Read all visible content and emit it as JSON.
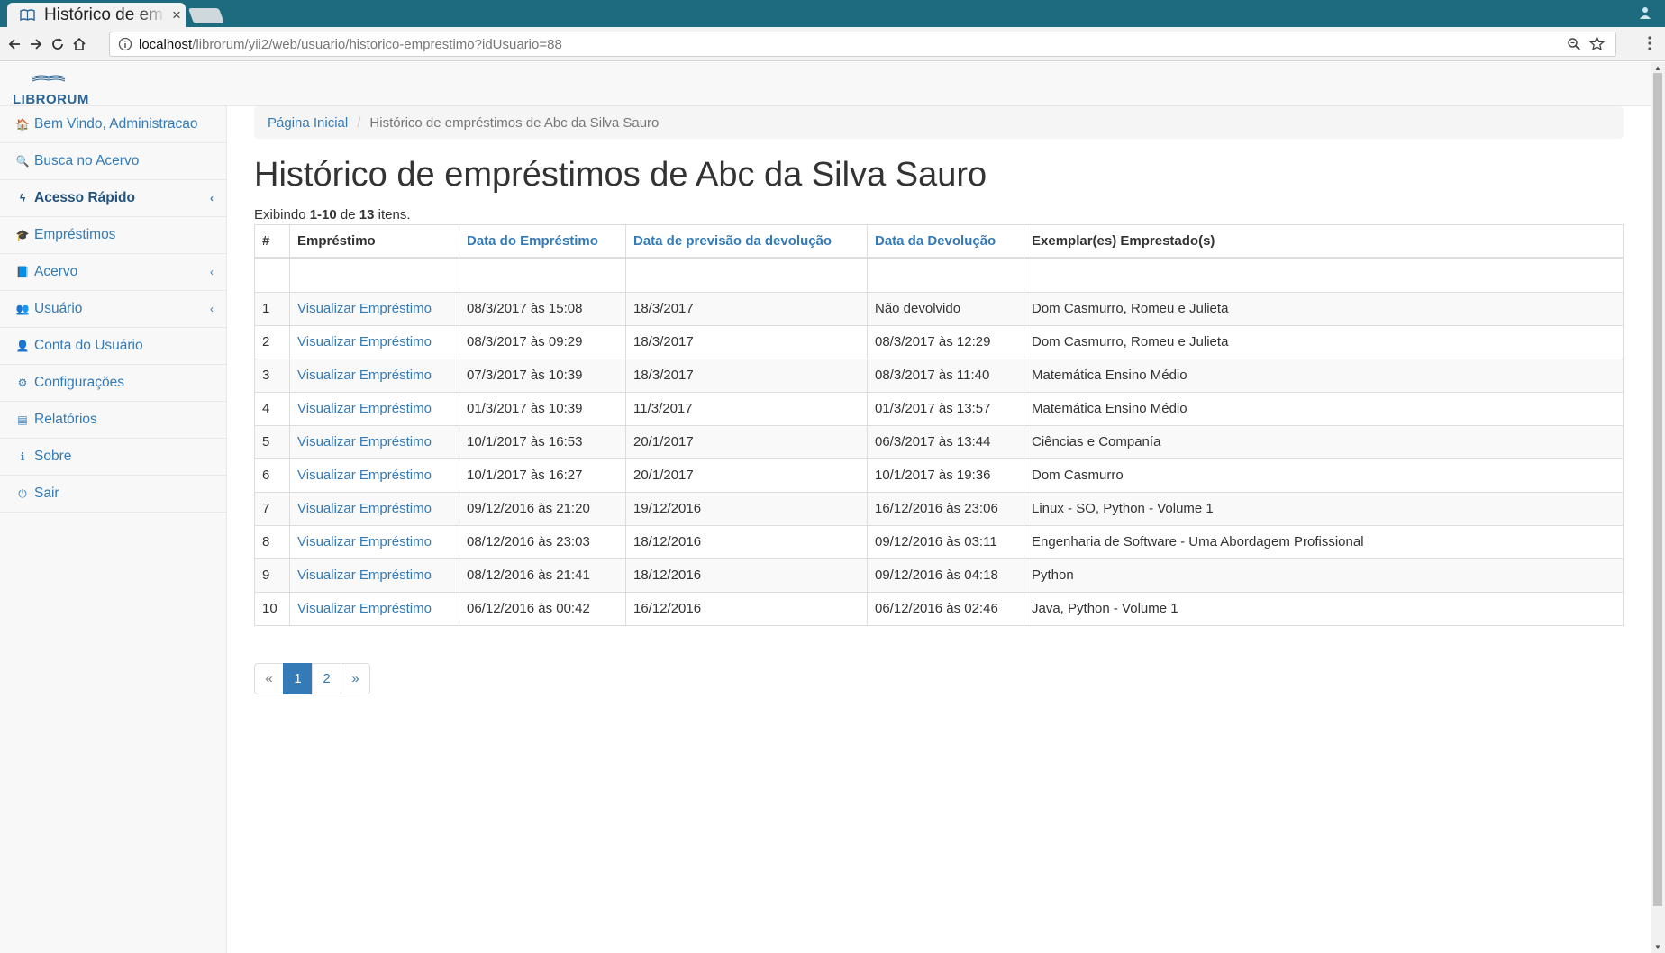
{
  "browser": {
    "tab_title": "Histórico de empréstimos",
    "close_glyph": "×",
    "url_host": "localhost",
    "url_path": "/librorum/yii2/web/usuario/historico-emprestimo?idUsuario=88"
  },
  "brand": {
    "logo_text": "LIBRORUM",
    "color": "#2a6496"
  },
  "sidebar": {
    "items": [
      {
        "label": "Bem Vindo, Administracao",
        "icon": "home-icon",
        "glyph": "🏠"
      },
      {
        "label": "Busca no Acervo",
        "icon": "search-icon",
        "glyph": "🔍"
      },
      {
        "label": "Acesso Rápido",
        "icon": "flash-icon",
        "glyph": "ϟ",
        "caret": "‹"
      },
      {
        "label": "Empréstimos",
        "icon": "graduation-cap-icon",
        "glyph": "🎓"
      },
      {
        "label": "Acervo",
        "icon": "book-icon",
        "glyph": "📘",
        "caret": "‹"
      },
      {
        "label": "Usuário",
        "icon": "users-icon",
        "glyph": "👥",
        "caret": "‹"
      },
      {
        "label": "Conta do Usuário",
        "icon": "user-icon",
        "glyph": "👤"
      },
      {
        "label": "Configurações",
        "icon": "gear-icon",
        "glyph": "⚙"
      },
      {
        "label": "Relatórios",
        "icon": "list-icon",
        "glyph": "▤"
      },
      {
        "label": "Sobre",
        "icon": "info-icon",
        "glyph": "ℹ"
      },
      {
        "label": "Sair",
        "icon": "power-icon",
        "glyph": "⏻"
      }
    ]
  },
  "breadcrumb": {
    "home": "Página Inicial",
    "separator": "/",
    "current": "Histórico de empréstimos de Abc da Silva Sauro"
  },
  "page_title": "Histórico de empréstimos de Abc da Silva Sauro",
  "summary": {
    "prefix": "Exibindo",
    "range": "1-10",
    "of": "de",
    "total": "13",
    "suffix": "itens."
  },
  "table": {
    "headers": [
      "#",
      "Empréstimo",
      "Data do Empréstimo",
      "Data de previsão da devolução",
      "Data da Devolução",
      "Exemplar(es) Emprestado(s)"
    ],
    "rows": [
      [
        "1",
        "Visualizar Empréstimo",
        "08/3/2017 às 15:08",
        "18/3/2017",
        "Não devolvido",
        "Dom Casmurro, Romeu e Julieta"
      ],
      [
        "2",
        "Visualizar Empréstimo",
        "08/3/2017 às 09:29",
        "18/3/2017",
        "08/3/2017 às 12:29",
        "Dom Casmurro, Romeu e Julieta"
      ],
      [
        "3",
        "Visualizar Empréstimo",
        "07/3/2017 às 10:39",
        "18/3/2017",
        "08/3/2017 às 11:40",
        "Matemática Ensino Médio"
      ],
      [
        "4",
        "Visualizar Empréstimo",
        "01/3/2017 às 10:39",
        "11/3/2017",
        "01/3/2017 às 13:57",
        "Matemática Ensino Médio"
      ],
      [
        "5",
        "Visualizar Empréstimo",
        "10/1/2017 às 16:53",
        "20/1/2017",
        "06/3/2017 às 13:44",
        "Ciências e Companía"
      ],
      [
        "6",
        "Visualizar Empréstimo",
        "10/1/2017 às 16:27",
        "20/1/2017",
        "10/1/2017 às 19:36",
        "Dom Casmurro"
      ],
      [
        "7",
        "Visualizar Empréstimo",
        "09/12/2016 às 21:20",
        "19/12/2016",
        "16/12/2016 às 23:06",
        "Linux - SO, Python - Volume 1"
      ],
      [
        "8",
        "Visualizar Empréstimo",
        "08/12/2016 às 23:03",
        "18/12/2016",
        "09/12/2016 às 03:11",
        "Engenharia de Software - Uma Abordagem Profissional"
      ],
      [
        "9",
        "Visualizar Empréstimo",
        "08/12/2016 às 21:41",
        "18/12/2016",
        "09/12/2016 às 04:18",
        "Python"
      ],
      [
        "10",
        "Visualizar Empréstimo",
        "06/12/2016 às 00:42",
        "16/12/2016",
        "06/12/2016 às 02:46",
        "Java, Python - Volume 1"
      ]
    ]
  },
  "pagination": {
    "prev": "«",
    "pages": [
      "1",
      "2"
    ],
    "active": "1",
    "next": "»"
  },
  "colors": {
    "link": "#337ab7",
    "tabstrip": "#1e6b80",
    "active_page": "#337ab7"
  }
}
